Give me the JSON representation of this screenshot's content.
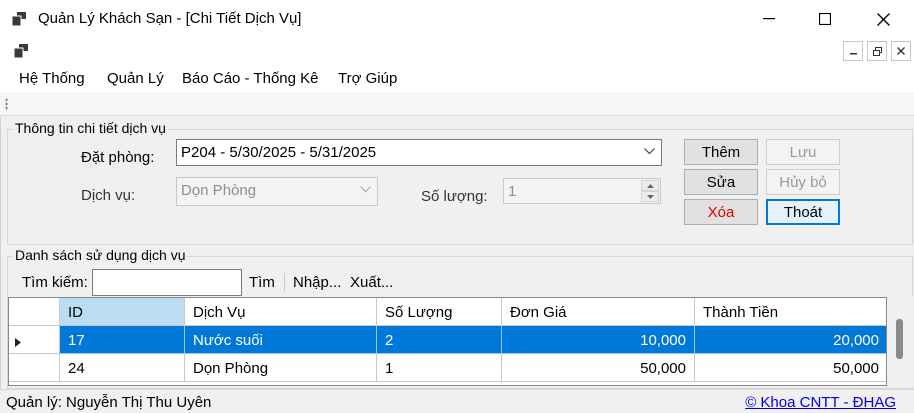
{
  "window": {
    "title": "Quản Lý Khách Sạn - [Chi Tiết Dịch Vụ]",
    "icon": "app-window-icon"
  },
  "menu": [
    "Hệ Thống",
    "Quản Lý",
    "Báo Cáo - Thống Kê",
    "Trợ Giúp"
  ],
  "detail": {
    "legend": "Thông tin chi tiết dịch vụ",
    "booking_label": "Đặt phòng:",
    "booking_value": "P204 - 5/30/2025 - 5/31/2025",
    "service_label": "Dịch vụ:",
    "service_value": "Dọn Phòng",
    "qty_label": "Số lượng:",
    "qty_value": "1",
    "buttons": {
      "add": "Thêm",
      "save": "Lưu",
      "edit": "Sửa",
      "cancel": "Hủy bỏ",
      "delete": "Xóa",
      "exit": "Thoát"
    }
  },
  "list": {
    "legend": "Danh sách sử dụng dịch vụ",
    "search_label": "Tìm kiếm:",
    "search_value": "",
    "find": "Tìm",
    "import": "Nhập...",
    "export": "Xuất...",
    "columns": [
      "ID",
      "Dịch Vụ",
      "Số Lượng",
      "Đơn Giá",
      "Thành Tiền"
    ],
    "rows": [
      {
        "id": "17",
        "service": "Nước suối",
        "qty": "2",
        "price": "10,000",
        "total": "20,000",
        "selected": true
      },
      {
        "id": "24",
        "service": "Dọn Phòng",
        "qty": "1",
        "price": "50,000",
        "total": "50,000",
        "selected": false
      }
    ]
  },
  "status": {
    "user": "Quản lý: Nguyễn Thị Thu Uyên",
    "credit": "© Khoa CNTT - ĐHAG"
  },
  "colors": {
    "selection": "#0078d7",
    "header_selected": "#bcdcf4",
    "delete_text": "#e00000",
    "link": "#0000e0"
  }
}
